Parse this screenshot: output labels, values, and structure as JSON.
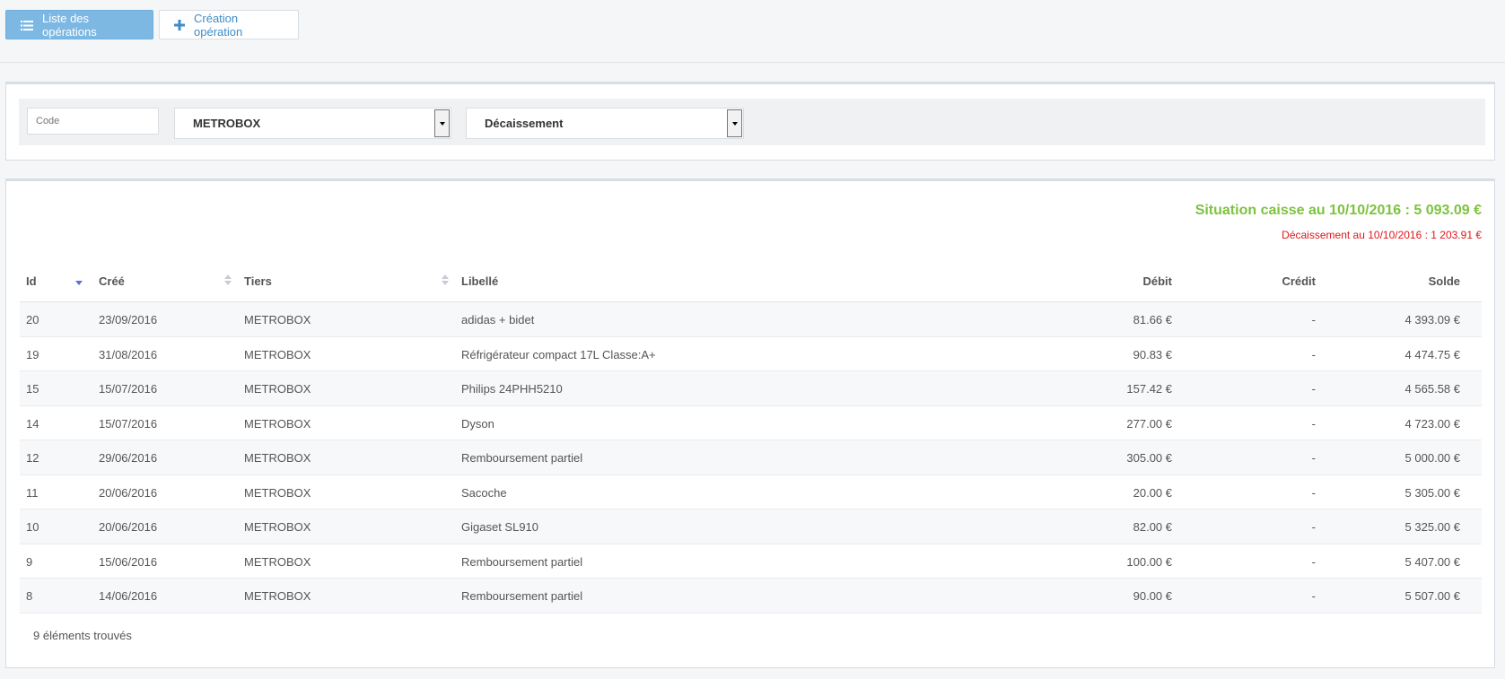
{
  "toolbar": {
    "list_label": "Liste des opérations",
    "create_label": "Création opération",
    "list_icon": "list-icon",
    "create_icon": "plus-icon"
  },
  "filters": {
    "code_placeholder": "Code",
    "tiers_selected": "METROBOX",
    "type_selected": "Décaissement"
  },
  "summary": {
    "situation": "Situation caisse au 10/10/2016 : 5 093.09 €",
    "decaissement": "Décaissement au 10/10/2016 : 1 203.91 €"
  },
  "colors": {
    "situation": "#7dc240",
    "decaissement": "#e0161b",
    "primary_button": "#7db8e3",
    "link": "#3c8dc9"
  },
  "table": {
    "headers": {
      "id": "Id",
      "cree": "Créé",
      "tiers": "Tiers",
      "libelle": "Libellé",
      "debit": "Débit",
      "credit": "Crédit",
      "solde": "Solde"
    },
    "rows": [
      {
        "id": "20",
        "cree": "23/09/2016",
        "tiers": "METROBOX",
        "libelle": "adidas + bidet",
        "debit": "81.66 €",
        "credit": "-",
        "solde": "4 393.09 €"
      },
      {
        "id": "19",
        "cree": "31/08/2016",
        "tiers": "METROBOX",
        "libelle": "Réfrigérateur compact 17L Classe:A+",
        "debit": "90.83 €",
        "credit": "-",
        "solde": "4 474.75 €"
      },
      {
        "id": "15",
        "cree": "15/07/2016",
        "tiers": "METROBOX",
        "libelle": "Philips 24PHH5210",
        "debit": "157.42 €",
        "credit": "-",
        "solde": "4 565.58 €"
      },
      {
        "id": "14",
        "cree": "15/07/2016",
        "tiers": "METROBOX",
        "libelle": "Dyson",
        "debit": "277.00 €",
        "credit": "-",
        "solde": "4 723.00 €"
      },
      {
        "id": "12",
        "cree": "29/06/2016",
        "tiers": "METROBOX",
        "libelle": "Remboursement partiel",
        "debit": "305.00 €",
        "credit": "-",
        "solde": "5 000.00 €"
      },
      {
        "id": "11",
        "cree": "20/06/2016",
        "tiers": "METROBOX",
        "libelle": "Sacoche",
        "debit": "20.00 €",
        "credit": "-",
        "solde": "5 305.00 €"
      },
      {
        "id": "10",
        "cree": "20/06/2016",
        "tiers": "METROBOX",
        "libelle": "Gigaset SL910",
        "debit": "82.00 €",
        "credit": "-",
        "solde": "5 325.00 €"
      },
      {
        "id": "9",
        "cree": "15/06/2016",
        "tiers": "METROBOX",
        "libelle": "Remboursement partiel",
        "debit": "100.00 €",
        "credit": "-",
        "solde": "5 407.00 €"
      },
      {
        "id": "8",
        "cree": "14/06/2016",
        "tiers": "METROBOX",
        "libelle": "Remboursement partiel",
        "debit": "90.00 €",
        "credit": "-",
        "solde": "5 507.00 €"
      }
    ],
    "count_label": "9 éléments trouvés"
  }
}
